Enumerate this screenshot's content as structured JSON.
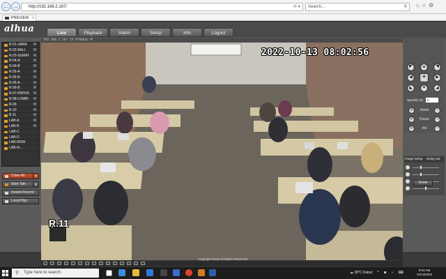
{
  "browser": {
    "url": "http://192.168.2.167/",
    "search_placeholder": "Search...",
    "tab_title": "PREVIEW"
  },
  "app": {
    "logo": "alhua",
    "menu": [
      {
        "label": "Live",
        "active": true
      },
      {
        "label": "Playback",
        "active": false
      },
      {
        "label": "Alarm",
        "active": false
      },
      {
        "label": "Setup",
        "active": false
      },
      {
        "label": "Info",
        "active": false
      },
      {
        "label": "Logout",
        "active": false
      }
    ]
  },
  "channels": [
    {
      "label": "R.01-JAWA",
      "stream": "M"
    },
    {
      "label": "R.02-BALI",
      "stream": "M"
    },
    {
      "label": "R.03-SUMAT",
      "stream": "M"
    },
    {
      "label": "R.04-A",
      "stream": "M"
    },
    {
      "label": "R.04-B",
      "stream": "M"
    },
    {
      "label": "R.05-A",
      "stream": "M"
    },
    {
      "label": "R.05-B",
      "stream": "M"
    },
    {
      "label": "R.06-A",
      "stream": "M"
    },
    {
      "label": "R.06-B",
      "stream": "M"
    },
    {
      "label": "R.07-PAPUA",
      "stream": "M"
    },
    {
      "label": "R.08-LOMBI",
      "stream": "M"
    },
    {
      "label": "R.09",
      "stream": "M"
    },
    {
      "label": "R.10",
      "stream": "M"
    },
    {
      "label": "R.11",
      "stream": "M"
    },
    {
      "label": "LAB-A",
      "stream": "M"
    },
    {
      "label": "LAB-B",
      "stream": "M"
    },
    {
      "label": "LAB-C",
      "stream": ""
    },
    {
      "label": "LAB-D",
      "stream": ""
    },
    {
      "label": "LAB-IRSN",
      "stream": ""
    },
    {
      "label": "LAB-N...",
      "stream": ""
    }
  ],
  "sidebar_buttons": {
    "close_all": "Close All",
    "start_talk": "Start Talk",
    "instant_record": "Instant Record",
    "local_play": "Local Play"
  },
  "video": {
    "title": "192.168.2.167 1h 9766bps M",
    "osd_time": "2022-10-13 08:02:56",
    "osd_name": "R.11"
  },
  "ptz": {
    "speed_label": "Speed(1-8):",
    "speed_value": "5",
    "zoom_label": "Zoom",
    "focus_label": "Focus",
    "iris_label": "Iris"
  },
  "image_setup": {
    "tab_left": "Image Setup",
    "tab_right": "Relay-out",
    "reset": "Reset",
    "levels": [
      0.25,
      0.25,
      0.35,
      0.45
    ]
  },
  "footer": {
    "copyright": "Copyright 2015,All Rights Reserved."
  },
  "taskbar": {
    "search_placeholder": "Type here to search",
    "weather": "28°C  Kabut",
    "time": "8:03 AM",
    "date": "10/13/2022"
  }
}
